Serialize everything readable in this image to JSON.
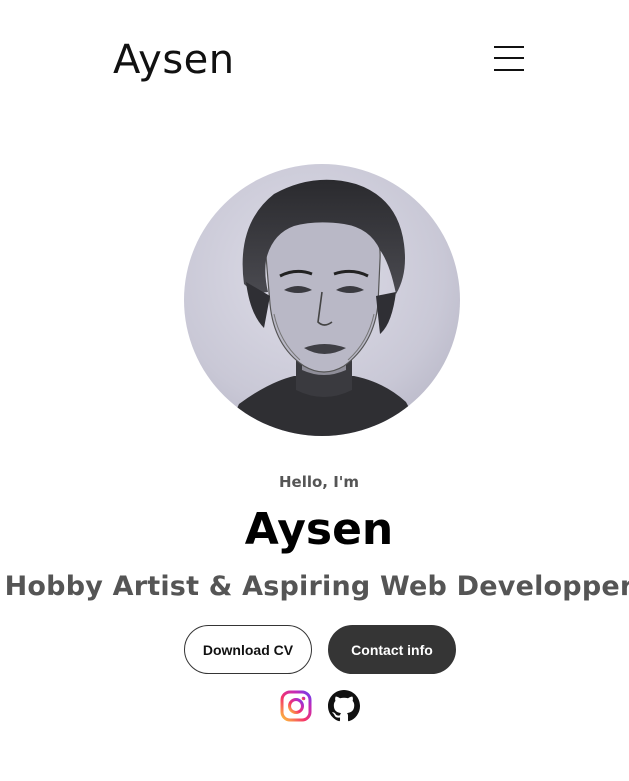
{
  "header": {
    "logo_text": "Aysen"
  },
  "profile": {
    "greeting": "Hello, I'm",
    "name": "Aysen",
    "title": "Hobby Artist & Aspiring Web Developper"
  },
  "buttons": {
    "download_cv": "Download CV",
    "contact_info": "Contact info"
  },
  "socials": [
    {
      "icon": "instagram-icon"
    },
    {
      "icon": "github-icon"
    }
  ],
  "colors": {
    "text_primary": "#111111",
    "text_secondary": "#555555",
    "button_dark": "#353535",
    "background": "#ffffff"
  }
}
